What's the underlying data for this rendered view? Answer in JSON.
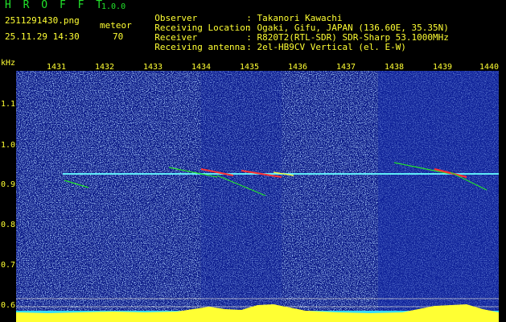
{
  "app": {
    "title": "H R O F F T",
    "version": "1.0.0"
  },
  "file": {
    "name": "2511291430.png",
    "timestamp": "25.11.29 14:30"
  },
  "meteor": {
    "label": "meteor",
    "count": "70"
  },
  "info": [
    {
      "key": "Observer",
      "sep": ":",
      "value": "Takanori Kawachi"
    },
    {
      "key": "Receiving Location",
      "sep": ":",
      "value": "Ogaki, Gifu, JAPAN (136.60E, 35.35N)"
    },
    {
      "key": "Receiver",
      "sep": ":",
      "value": "R820T2(RTL-SDR) SDR-Sharp 53.1000MHz"
    },
    {
      "key": "Receiving antenna",
      "sep": ":",
      "value": "2el-HB9CV Vertical (el. E-W)"
    }
  ],
  "axis": {
    "unit": "kHz",
    "x_ticks": [
      "1431",
      "1432",
      "1433",
      "1434",
      "1435",
      "1436",
      "1437",
      "1438",
      "1439",
      "1440"
    ],
    "y_ticks": [
      "1.1",
      "1.0",
      "0.9",
      "0.8",
      "0.7",
      "0.6"
    ]
  },
  "colors": {
    "green": "#22e32b",
    "yellow": "#ffff33",
    "cyan": "#33ddff",
    "background": "#0b1a8a"
  }
}
